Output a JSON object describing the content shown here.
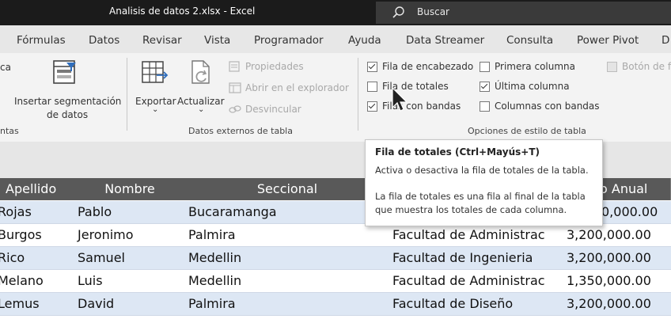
{
  "window": {
    "title": "Analisis de datos 2.xlsx  -  Excel",
    "search_placeholder": "Buscar"
  },
  "tabs": [
    "Fórmulas",
    "Datos",
    "Revisar",
    "Vista",
    "Programador",
    "Ayuda",
    "Data Streamer",
    "Consulta",
    "Power Pivot",
    "D"
  ],
  "ribbon": {
    "left_fragment": "ca",
    "left_group_fragment": "ntas",
    "slicer": {
      "line1": "Insertar segmentación",
      "line2": "de datos"
    },
    "external": {
      "export_label": "Exportar",
      "refresh_label": "Actualizar",
      "properties": "Propiedades",
      "open_browser": "Abrir en el explorador",
      "unlink": "Desvincular",
      "group_label": "Datos externos de tabla"
    },
    "style_options": {
      "header_row": "Fila de encabezado",
      "total_row": "Fila de totales",
      "banded_rows": "Filas con bandas",
      "first_column": "Primera columna",
      "last_column": "Última columna",
      "banded_columns": "Columnas con bandas",
      "filter_button": "Botón de f",
      "group_label": "Opciones de estilo de tabla"
    }
  },
  "tooltip": {
    "title": "Fila de totales (Ctrl+Mayús+T)",
    "line1": "Activa o desactiva la fila de totales de la tabla.",
    "line2": "La fila de totales es una fila al final de la tabla",
    "line3": "que muestra los totales de cada columna."
  },
  "table": {
    "headers": [
      "Apellido",
      "Nombre",
      "Seccional",
      "",
      "o Anual"
    ],
    "rows": [
      [
        "Rojas",
        "Pablo",
        "Bucaramanga",
        "",
        "0,000.00"
      ],
      [
        "Burgos",
        "Jeronimo",
        "Palmira",
        "Facultad de Administrac",
        "3,200,000.00"
      ],
      [
        "Rico",
        "Samuel",
        "Medellin",
        "Facultad de Ingenieria",
        "3,200,000.00"
      ],
      [
        "Melano",
        "Luis",
        "Medellin",
        "Facultad de Administrac",
        "1,350,000.00"
      ],
      [
        "Lemus",
        "David",
        "Palmira",
        "Facultad de Diseño",
        "3,200,000.00"
      ]
    ]
  },
  "colors": {
    "header_bg": "#595959",
    "band_blue": "#dde7f4",
    "title_bar": "#1b1b1b"
  }
}
